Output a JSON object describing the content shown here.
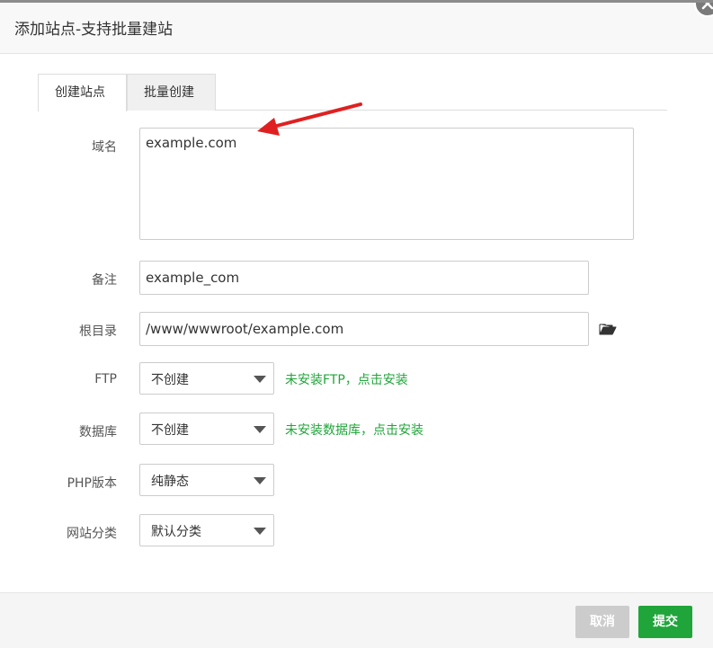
{
  "dialog": {
    "title": "添加站点-支持批量建站"
  },
  "tabs": [
    {
      "label": "创建站点",
      "active": true
    },
    {
      "label": "批量创建",
      "active": false
    }
  ],
  "form": {
    "domain": {
      "label": "域名",
      "value": "example.com"
    },
    "remark": {
      "label": "备注",
      "value": "example_com"
    },
    "root_dir": {
      "label": "根目录",
      "value": "/www/wwwroot/example.com",
      "icon": "folder-open-icon"
    },
    "ftp": {
      "label": "FTP",
      "selected": "不创建",
      "hint": "未安装FTP，点击安装"
    },
    "database": {
      "label": "数据库",
      "selected": "不创建",
      "hint": "未安装数据库，点击安装"
    },
    "php_version": {
      "label": "PHP版本",
      "selected": "纯静态"
    },
    "site_category": {
      "label": "网站分类",
      "selected": "默认分类"
    }
  },
  "footer": {
    "cancel_label": "取消",
    "submit_label": "提交"
  },
  "colors": {
    "primary_green": "#20a53a",
    "cancel_gray": "#cccccc",
    "annotation_red": "#e02020"
  }
}
